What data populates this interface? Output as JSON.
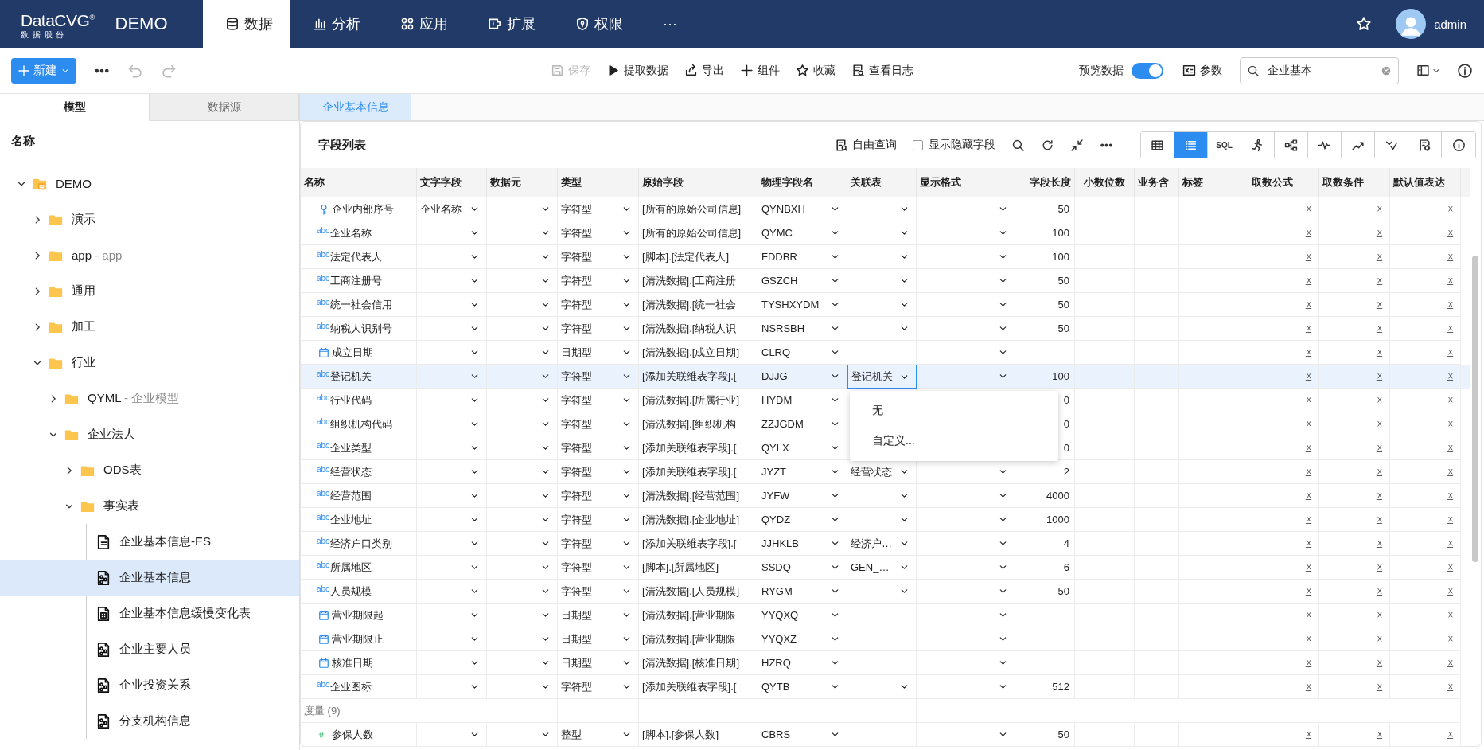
{
  "nav": {
    "logo": "DataCVG$^{®}$",
    "logo_sub": "数 据 股 份",
    "app": "DEMO",
    "user": "admin",
    "tabs": [
      {
        "label": "数据",
        "selected": true
      },
      {
        "label": "分析",
        "selected": false
      },
      {
        "label": "应用",
        "selected": false
      },
      {
        "label": "扩展",
        "selected": false
      },
      {
        "label": "权限",
        "selected": false
      },
      {
        "label": "···",
        "selected": false
      }
    ]
  },
  "toolbar": {
    "new_button": "新建",
    "actions": [
      {
        "label": "保存",
        "disabled": true
      },
      {
        "label": "提取数据",
        "disabled": false
      },
      {
        "label": "导出",
        "disabled": false
      },
      {
        "label": "组件",
        "disabled": false
      },
      {
        "label": "收藏",
        "disabled": false
      },
      {
        "label": "查看日志",
        "disabled": false
      }
    ],
    "preview": {
      "label": "预览数据",
      "on": true
    },
    "params": "参数",
    "search": {
      "value": "企业基本"
    }
  },
  "left_tabs": [
    {
      "label": "模型",
      "selected": true
    },
    {
      "label": "数据源",
      "selected": false
    }
  ],
  "doc_tabs": [
    {
      "label": "企业基本信息",
      "selected": true
    }
  ],
  "sidebar": {
    "heading": "名称",
    "tree": [
      {
        "label": "DEMO",
        "kind": "root",
        "expanded": true,
        "selected": false,
        "children": [
          {
            "label": "演示",
            "kind": "folder",
            "expanded": false,
            "selected": false
          },
          {
            "label": "app",
            "suffix": "- app",
            "kind": "folder",
            "expanded": false,
            "selected": false
          },
          {
            "label": "通用",
            "kind": "folder",
            "expanded": false,
            "selected": false
          },
          {
            "label": "加工",
            "kind": "folder",
            "expanded": false,
            "selected": false
          },
          {
            "label": "行业",
            "kind": "folder",
            "expanded": true,
            "selected": false,
            "children": [
              {
                "label": "QYML",
                "suffix": "- 企业模型",
                "kind": "folder",
                "expanded": false,
                "selected": false
              },
              {
                "label": "企业法人",
                "kind": "folder",
                "expanded": true,
                "selected": false,
                "children": [
                  {
                    "label": "ODS表",
                    "kind": "folder",
                    "expanded": false,
                    "selected": false
                  },
                  {
                    "label": "事实表",
                    "kind": "folder",
                    "expanded": true,
                    "selected": false,
                    "children": [
                      {
                        "label": "企业基本信息-ES",
                        "kind": "list",
                        "selected": false
                      },
                      {
                        "label": "企业基本信息",
                        "kind": "flow",
                        "selected": true
                      },
                      {
                        "label": "企业基本信息缓慢变化表",
                        "kind": "table",
                        "selected": false
                      },
                      {
                        "label": "企业主要人员",
                        "kind": "flow",
                        "selected": false
                      },
                      {
                        "label": "企业投资关系",
                        "kind": "flow",
                        "selected": false
                      },
                      {
                        "label": "分支机构信息",
                        "kind": "flow",
                        "selected": false
                      }
                    ]
                  }
                ]
              }
            ]
          }
        ]
      }
    ]
  },
  "panel": {
    "title": "字段列表",
    "free_query": "自由查询",
    "show_hidden": {
      "label": "显示隐藏字段",
      "checked": false
    },
    "views": [
      {
        "selected": false
      },
      {
        "selected": true
      },
      {
        "label": "SQL",
        "selected": false
      },
      {
        "selected": false
      },
      {
        "selected": false
      },
      {
        "selected": false
      },
      {
        "selected": false
      },
      {
        "selected": false
      },
      {
        "selected": false
      },
      {
        "selected": false
      }
    ]
  },
  "table": {
    "columns": [
      "名称",
      "文字字段",
      "数据元",
      "类型",
      "原始字段",
      "物理字段名",
      "关联表",
      "显示格式",
      "字段长度",
      "小数位数",
      "业务含",
      "标签",
      "取数公式",
      "取数条件",
      "默认值表达"
    ],
    "menu": {
      "items": [
        "无",
        "自定义..."
      ]
    },
    "rows": [
      {
        "kind": "key",
        "name": "企业内部序号",
        "text_field": "企业名称",
        "type": "字符型",
        "origin": "[所有的原始公司信息]",
        "physical": "QYNBXH",
        "relation_select": true,
        "format_select": true,
        "length": "50",
        "selected": false
      },
      {
        "kind": "text",
        "badge": "abc",
        "name": "企业名称",
        "type": "字符型",
        "origin": "[所有的原始公司信息]",
        "physical": "QYMC",
        "relation_select": true,
        "format_select": true,
        "length": "100",
        "selected": false
      },
      {
        "kind": "text",
        "badge": "abc",
        "name": "法定代表人",
        "type": "字符型",
        "origin": "[脚本].[法定代表人]",
        "physical": "FDDBR",
        "relation_select": true,
        "format_select": true,
        "length": "100",
        "selected": false
      },
      {
        "kind": "text",
        "badge": "abc",
        "name": "工商注册号",
        "type": "字符型",
        "origin": "[清洗数据].[工商注册",
        "physical": "GSZCH",
        "relation_select": true,
        "format_select": true,
        "length": "50",
        "selected": false
      },
      {
        "kind": "text",
        "badge": "abc",
        "name": "统一社会信用",
        "type": "字符型",
        "origin": "[清洗数据].[统一社会",
        "physical": "TYSHXYDM",
        "relation_select": true,
        "format_select": true,
        "length": "50",
        "selected": false
      },
      {
        "kind": "text",
        "badge": "abc",
        "name": "纳税人识别号",
        "type": "字符型",
        "origin": "[清洗数据].[纳税人识",
        "physical": "NSRSBH",
        "relation_select": true,
        "format_select": true,
        "length": "50",
        "selected": false
      },
      {
        "kind": "date",
        "name": "成立日期",
        "type": "日期型",
        "origin": "[清洗数据].[成立日期]",
        "physical": "CLRQ",
        "relation_select": false,
        "format_select": true,
        "selected": false
      },
      {
        "kind": "text",
        "badge": "abc",
        "name": "登记机关",
        "type": "字符型",
        "origin": "[添加关联维表字段].[",
        "physical": "DJJG",
        "relation": "登记机关",
        "relation_select": true,
        "format_select": true,
        "length": "100",
        "selected": true
      },
      {
        "kind": "text",
        "badge": "abc",
        "name": "行业代码",
        "type": "字符型",
        "origin": "[清洗数据].[所属行业]",
        "physical": "HYDM",
        "length": "0",
        "selected": false
      },
      {
        "kind": "text",
        "badge": "abc",
        "name": "组织机构代码",
        "type": "字符型",
        "origin": "[清洗数据].[组织机构",
        "physical": "ZZJGDM",
        "length": "0",
        "selected": false
      },
      {
        "kind": "text",
        "badge": "abc",
        "name": "企业类型",
        "type": "字符型",
        "origin": "[添加关联维表字段].[",
        "physical": "QYLX",
        "length": "0",
        "selected": false
      },
      {
        "kind": "text",
        "badge": "abc",
        "name": "经营状态",
        "type": "字符型",
        "origin": "[添加关联维表字段].[",
        "physical": "JYZT",
        "relation": "经营状态",
        "relation_select": true,
        "format_select": true,
        "length": "2",
        "selected": false
      },
      {
        "kind": "text",
        "badge": "abc",
        "name": "经营范围",
        "type": "字符型",
        "origin": "[清洗数据].[经营范围]",
        "physical": "JYFW",
        "relation_select": true,
        "format_select": true,
        "length": "4000",
        "selected": false
      },
      {
        "kind": "text",
        "badge": "abc",
        "name": "企业地址",
        "type": "字符型",
        "origin": "[清洗数据].[企业地址]",
        "physical": "QYDZ",
        "relation_select": true,
        "format_select": true,
        "length": "1000",
        "selected": false
      },
      {
        "kind": "text",
        "badge": "abc",
        "name": "经济户口类别",
        "type": "字符型",
        "origin": "[添加关联维表字段].[",
        "physical": "JJHKLB",
        "relation": "经济户…",
        "relation_select": true,
        "format_select": true,
        "length": "4",
        "selected": false
      },
      {
        "kind": "text",
        "badge": "abc",
        "name": "所属地区",
        "type": "字符型",
        "origin": "[脚本].[所属地区]",
        "physical": "SSDQ",
        "relation": "GEN_…",
        "relation_select": true,
        "format_select": true,
        "length": "6",
        "selected": false
      },
      {
        "kind": "text",
        "badge": "abc",
        "name": "人员规模",
        "type": "字符型",
        "origin": "[清洗数据].[人员规模]",
        "physical": "RYGM",
        "relation_select": true,
        "format_select": true,
        "length": "50",
        "selected": false
      },
      {
        "kind": "date",
        "name": "营业期限起",
        "type": "日期型",
        "origin": "[清洗数据].[营业期限",
        "physical": "YYQXQ",
        "relation_select": false,
        "format_select": true,
        "selected": false
      },
      {
        "kind": "date",
        "name": "营业期限止",
        "type": "日期型",
        "origin": "[清洗数据].[营业期限",
        "physical": "YYQXZ",
        "relation_select": false,
        "format_select": true,
        "selected": false
      },
      {
        "kind": "date",
        "name": "核准日期",
        "type": "日期型",
        "origin": "[清洗数据].[核准日期]",
        "physical": "HZRQ",
        "relation_select": false,
        "format_select": true,
        "selected": false
      },
      {
        "kind": "text",
        "badge": "abc",
        "name": "企业图标",
        "type": "字符型",
        "origin": "[添加关联维表字段].[",
        "physical": "QYTB",
        "relation_select": true,
        "format_select": true,
        "length": "512",
        "selected": false
      },
      {
        "kind": "group",
        "name": "度量 (9)"
      },
      {
        "kind": "number",
        "name": "参保人数",
        "type": "整型",
        "origin": "[脚本].[参保人数]",
        "physical": "CBRS",
        "relation_select": false,
        "format_select": true,
        "length": "50",
        "selected": false
      }
    ]
  }
}
